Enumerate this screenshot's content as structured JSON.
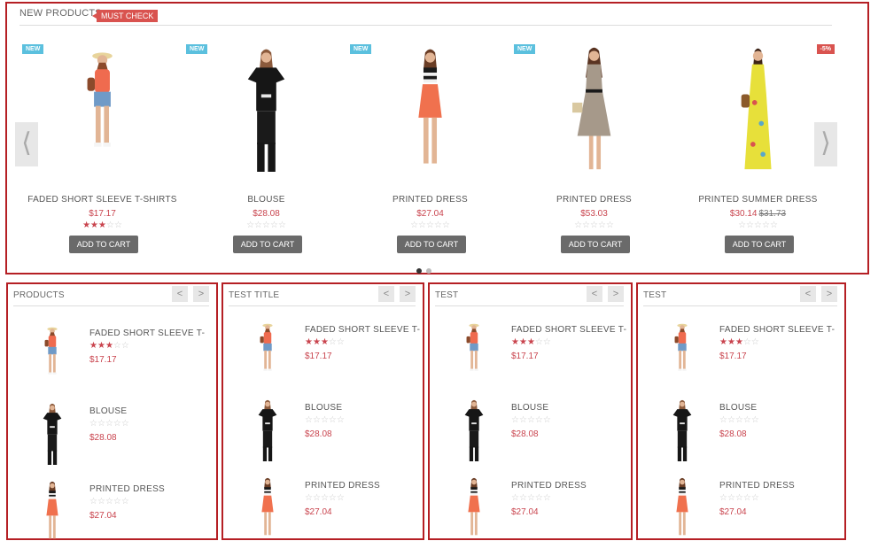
{
  "header": {
    "title": "NEW PRODUCTS",
    "badge": "MUST CHECK"
  },
  "carousel": {
    "prev_icon": "chevron-left-icon",
    "next_icon": "chevron-right-icon",
    "prev_glyph": "⟨",
    "next_glyph": "⟩",
    "dots": 2,
    "active_dot": 0
  },
  "products": [
    {
      "name": "FADED SHORT SLEEVE T-SHIRTS",
      "price": "$17.17",
      "old_price": "",
      "rating": 3,
      "label": "NEW",
      "cart": "ADD TO CART"
    },
    {
      "name": "BLOUSE",
      "price": "$28.08",
      "old_price": "",
      "rating": 0,
      "label": "NEW",
      "cart": "ADD TO CART"
    },
    {
      "name": "PRINTED DRESS",
      "price": "$27.04",
      "old_price": "",
      "rating": 0,
      "label": "NEW",
      "cart": "ADD TO CART"
    },
    {
      "name": "PRINTED DRESS",
      "price": "$53.03",
      "old_price": "",
      "rating": 0,
      "label": "NEW",
      "cart": "ADD TO CART"
    },
    {
      "name": "PRINTED SUMMER DRESS",
      "price": "$30.14",
      "old_price": "$31.73",
      "rating": 0,
      "label": "-5%",
      "cart": "ADD TO CART"
    }
  ],
  "mini_panels": [
    {
      "title": "PRODUCTS",
      "prev": "<",
      "next": ">",
      "items": [
        {
          "name": "FADED SHORT SLEEVE T-",
          "price": "$17.17",
          "rating": 3
        },
        {
          "name": "BLOUSE",
          "price": "$28.08",
          "rating": 0
        },
        {
          "name": "PRINTED DRESS",
          "price": "$27.04",
          "rating": 0
        }
      ]
    },
    {
      "title": "TEST TITLE",
      "prev": "<",
      "next": ">",
      "items": [
        {
          "name": "FADED SHORT SLEEVE T-",
          "price": "$17.17",
          "rating": 3
        },
        {
          "name": "BLOUSE",
          "price": "$28.08",
          "rating": 0
        },
        {
          "name": "PRINTED DRESS",
          "price": "$27.04",
          "rating": 0
        }
      ]
    },
    {
      "title": "TEST",
      "prev": "<",
      "next": ">",
      "items": [
        {
          "name": "FADED SHORT SLEEVE T-",
          "price": "$17.17",
          "rating": 3
        },
        {
          "name": "BLOUSE",
          "price": "$28.08",
          "rating": 0
        },
        {
          "name": "PRINTED DRESS",
          "price": "$27.04",
          "rating": 0
        }
      ]
    },
    {
      "title": "TEST",
      "prev": "<",
      "next": ">",
      "items": [
        {
          "name": "FADED SHORT SLEEVE T-",
          "price": "$17.17",
          "rating": 3
        },
        {
          "name": "BLOUSE",
          "price": "$28.08",
          "rating": 0
        },
        {
          "name": "PRINTED DRESS",
          "price": "$27.04",
          "rating": 0
        }
      ]
    }
  ],
  "colors": {
    "accent_red": "#c9444e",
    "panel_border": "#b51f24",
    "label_new": "#5bc0de",
    "label_sale": "#d9534f",
    "button_dark": "#6a6a6a"
  }
}
